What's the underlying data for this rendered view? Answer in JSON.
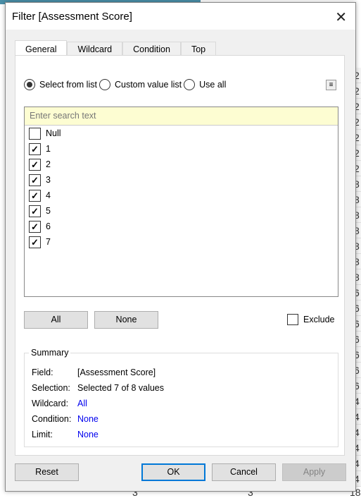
{
  "background": {
    "column_values": [
      "2",
      "2",
      "2",
      "2",
      "2",
      "2",
      "2",
      "8",
      "8",
      "8",
      "8",
      "8",
      "8",
      "8",
      "6",
      "6",
      "6",
      "6",
      "6",
      "6",
      "6",
      "4",
      "4",
      "4",
      "4",
      "4",
      "4"
    ],
    "bottom_values": [
      "3",
      "3",
      "18"
    ]
  },
  "dialog": {
    "title": "Filter [Assessment Score]",
    "tabs": [
      {
        "label": "General",
        "active": true
      },
      {
        "label": "Wildcard"
      },
      {
        "label": "Condition"
      },
      {
        "label": "Top"
      }
    ],
    "mode_options": [
      {
        "label": "Select from list",
        "selected": true
      },
      {
        "label": "Custom value list",
        "selected": false
      },
      {
        "label": "Use all",
        "selected": false
      }
    ],
    "search_placeholder": "Enter search text",
    "items": [
      {
        "label": "Null",
        "checked": false
      },
      {
        "label": "1",
        "checked": true
      },
      {
        "label": "2",
        "checked": true
      },
      {
        "label": "3",
        "checked": true
      },
      {
        "label": "4",
        "checked": true
      },
      {
        "label": "5",
        "checked": true
      },
      {
        "label": "6",
        "checked": true
      },
      {
        "label": "7",
        "checked": true
      }
    ],
    "all_label": "All",
    "none_label": "None",
    "exclude_label": "Exclude",
    "exclude_checked": false,
    "summary": {
      "heading": "Summary",
      "rows": [
        {
          "key": "Field:",
          "value": "[Assessment Score]",
          "link": false
        },
        {
          "key": "Selection:",
          "value": "Selected 7 of 8 values",
          "link": false
        },
        {
          "key": "Wildcard:",
          "value": "All",
          "link": true
        },
        {
          "key": "Condition:",
          "value": "None",
          "link": true
        },
        {
          "key": "Limit:",
          "value": "None",
          "link": true
        }
      ]
    },
    "buttons": {
      "reset": "Reset",
      "ok": "OK",
      "cancel": "Cancel",
      "apply": "Apply"
    },
    "colors": {
      "link": "#0000ee",
      "focus": "#0078d7",
      "search_bg": "#fdfdd2"
    }
  }
}
